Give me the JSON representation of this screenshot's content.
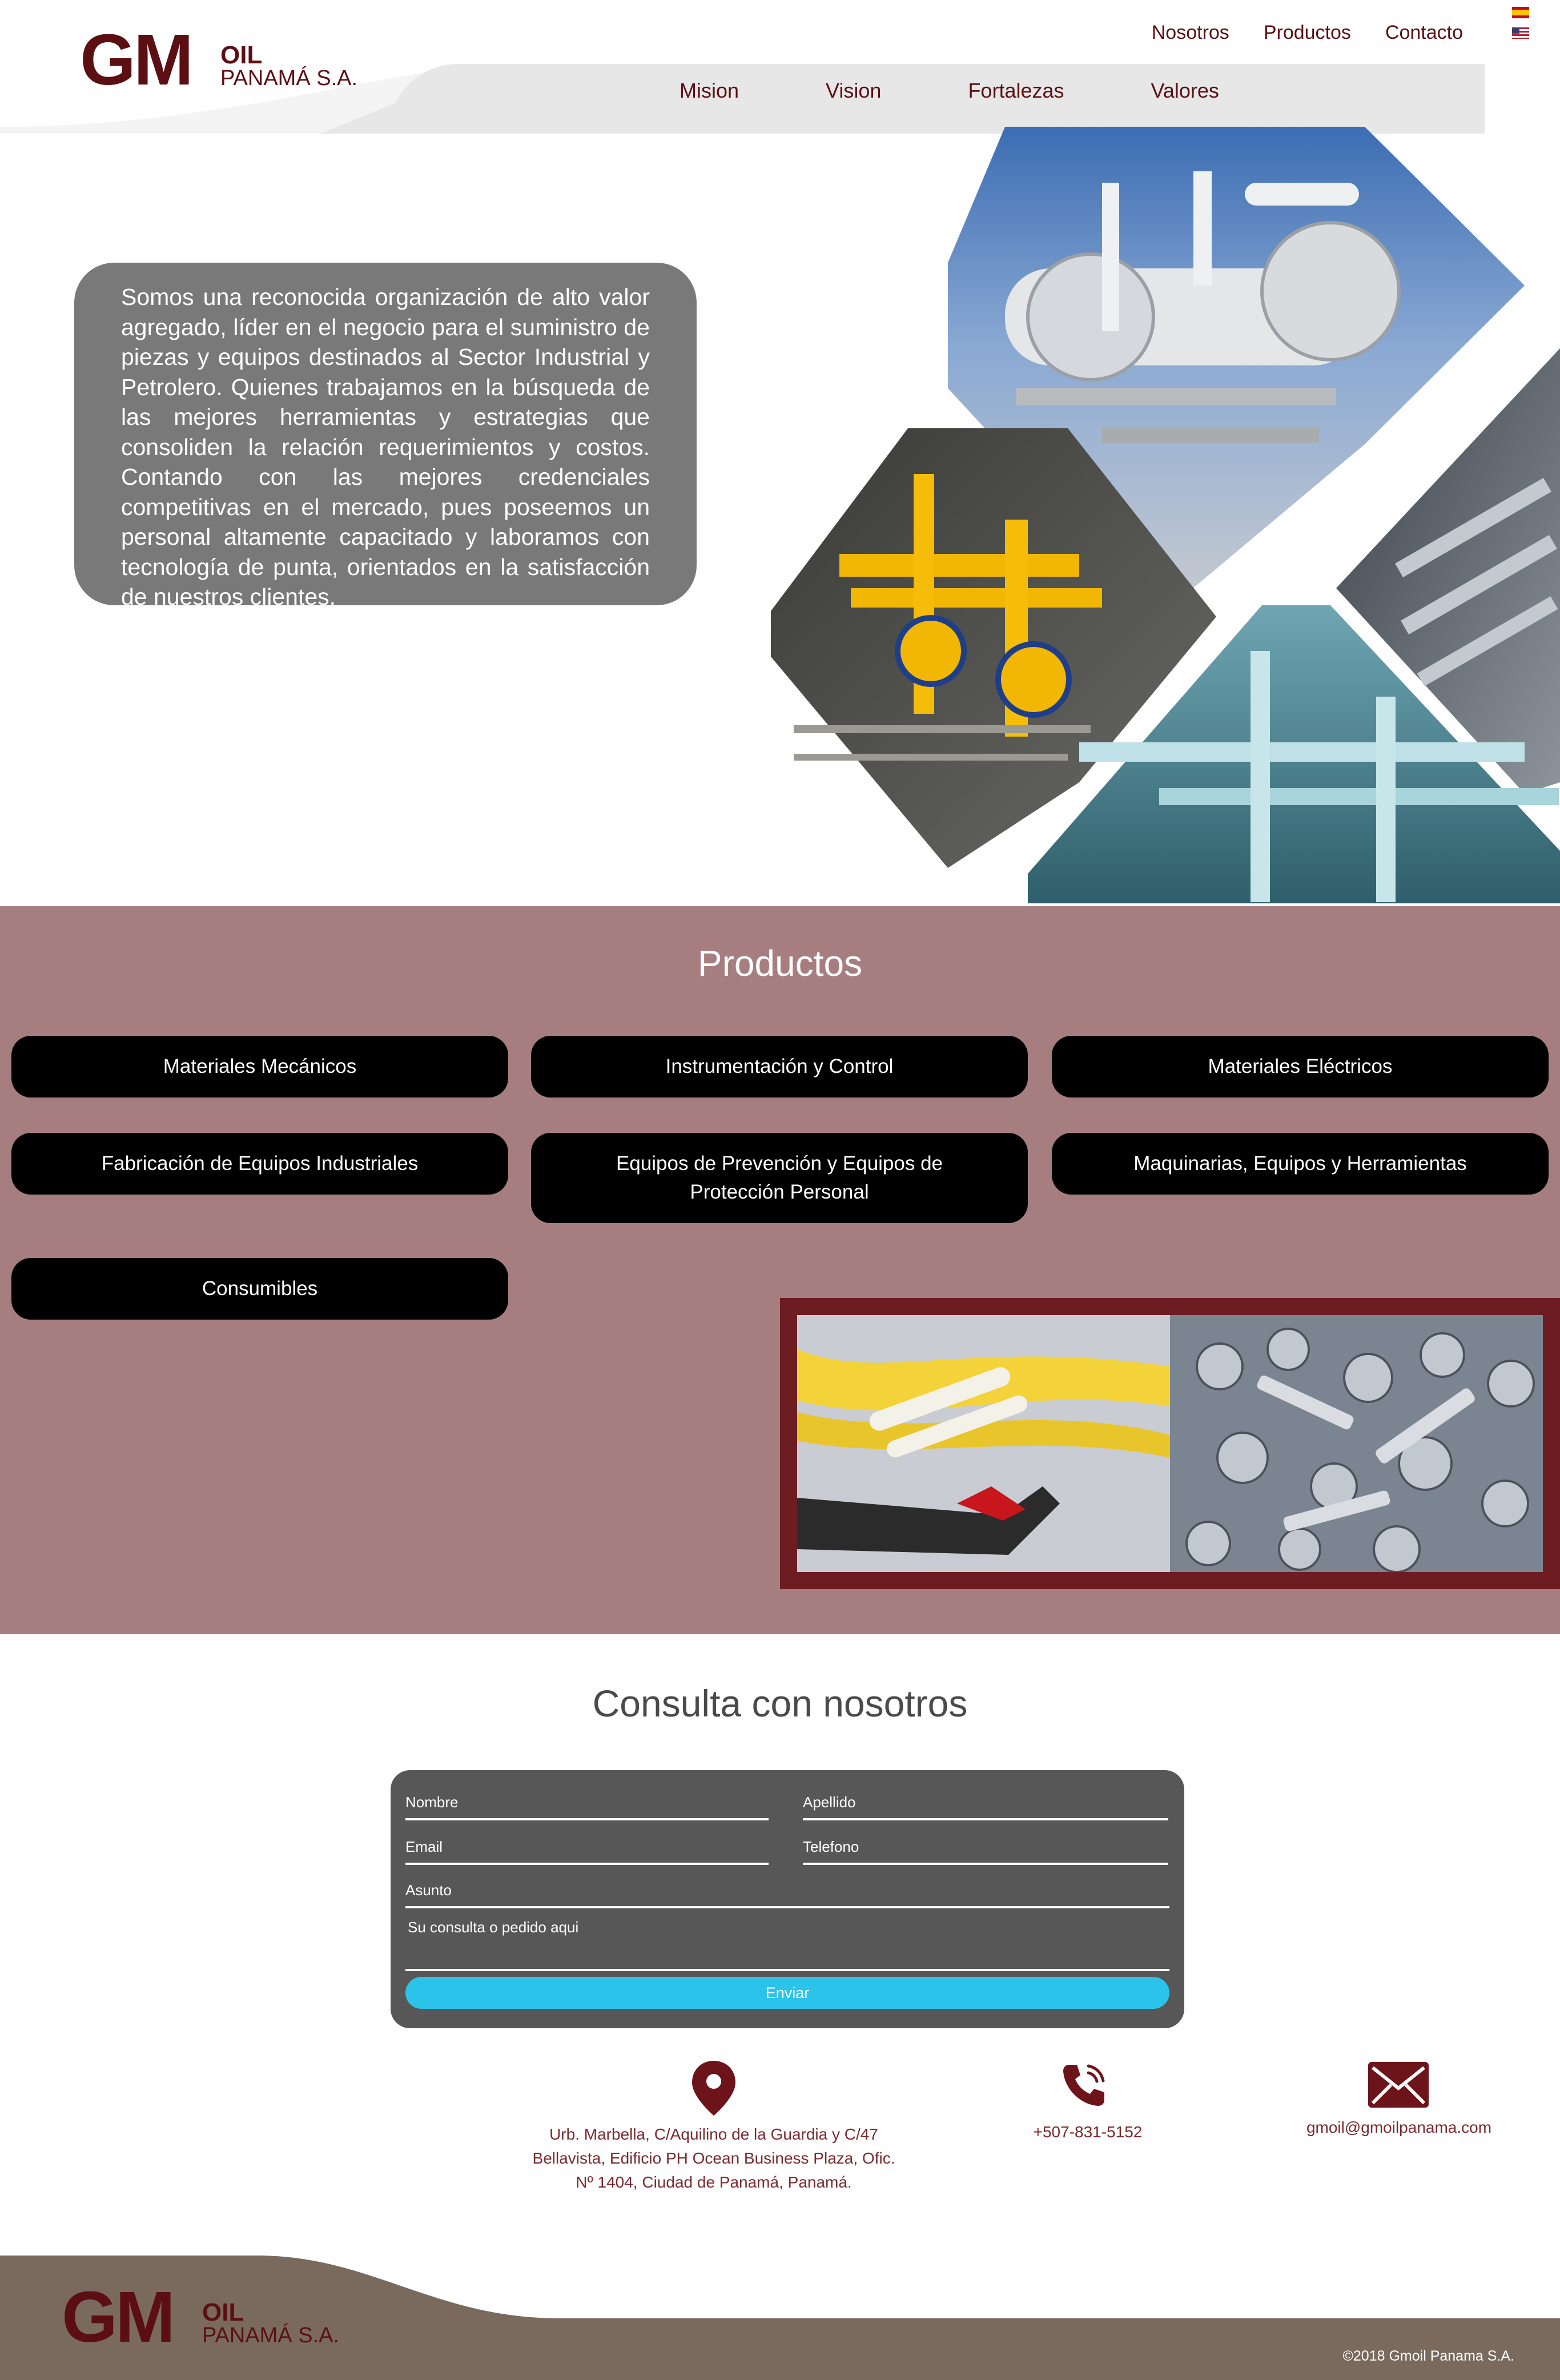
{
  "header": {
    "logo": {
      "gm": "GM",
      "oil": "OIL",
      "company": "PANAMÁ S.A."
    },
    "top_nav": [
      "Nosotros",
      "Productos",
      "Contacto"
    ],
    "sub_nav": [
      "Mision",
      "Vision",
      "Fortalezas",
      "Valores"
    ],
    "languages": [
      "es-flag-icon",
      "us-flag-icon"
    ]
  },
  "hero": {
    "text": "Somos una reconocida organización de alto valor agregado, líder en el negocio para el suministro de piezas y equipos destinados al Sector Industrial y Petrolero. Quienes trabajamos en la búsqueda de las mejores herramientas y estrategias que consoliden la relación requerimientos y costos. Contando con las mejores credenciales competitivas en el mercado, pues poseemos un personal altamente capacitado y laboramos con tecnología de punta, orientados en la satisfacción de nuestros clientes."
  },
  "productos": {
    "title": "Productos",
    "items": [
      "Materiales Mecánicos",
      "Instrumentación y Control",
      "Materiales Eléctricos",
      "Fabricación de Equipos Industriales",
      "Equipos de Prevención y Equipos de Protección Personal",
      "Maquinarias, Equipos y Herramientas",
      "Consumibles"
    ]
  },
  "consulta": {
    "title": "Consulta con nosotros",
    "fields": {
      "nombre": "Nombre",
      "apellido": "Apellido",
      "email": "Email",
      "telefono": "Telefono",
      "asunto": "Asunto",
      "mensaje": "Su consulta o pedido aqui"
    },
    "submit": "Enviar"
  },
  "contact": {
    "address_lines": [
      "Urb. Marbella, C/Aquilino de la Guardia y C/47",
      "Bellavista, Edificio PH Ocean Business Plaza, Ofic.",
      "Nº 1404, Ciudad de Panamá, Panamá."
    ],
    "phone": "+507-831-5152",
    "email": "gmoil@gmoilpanama.com"
  },
  "footer": {
    "copyright": "©2018 Gmoil Panama S.A."
  },
  "colors": {
    "brand": "#5b0f13",
    "productos_bg": "#a77e7f",
    "form_bg": "#575757",
    "submit": "#2cc3ea",
    "footer": "#7a6a5d"
  }
}
